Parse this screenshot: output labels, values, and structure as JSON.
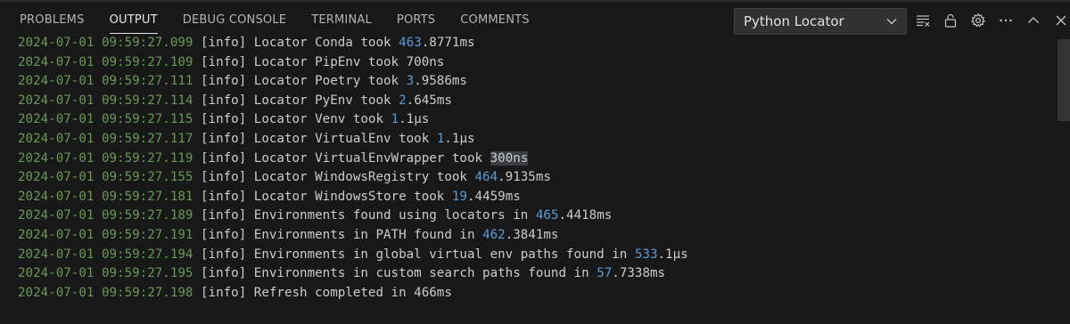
{
  "tabs": [
    {
      "label": "PROBLEMS",
      "active": false
    },
    {
      "label": "OUTPUT",
      "active": true
    },
    {
      "label": "DEBUG CONSOLE",
      "active": false
    },
    {
      "label": "TERMINAL",
      "active": false
    },
    {
      "label": "PORTS",
      "active": false
    },
    {
      "label": "COMMENTS",
      "active": false
    }
  ],
  "channel_select": {
    "selected": "Python Locator",
    "icon": "chevron-down-icon"
  },
  "actions": [
    {
      "name": "clear-output-icon"
    },
    {
      "name": "lock-scroll-icon"
    },
    {
      "name": "settings-gear-icon"
    },
    {
      "name": "more-actions-icon"
    },
    {
      "name": "maximize-panel-icon"
    },
    {
      "name": "close-panel-icon"
    }
  ],
  "colors": {
    "background": "#181818",
    "timestamp": "#6a9955",
    "number": "#569cd6",
    "text": "#cccccc",
    "selection": "#3a3d41"
  },
  "log_lines": [
    {
      "ts": "2024-07-01 09:59:27.099",
      "level": "[info]",
      "segments": [
        {
          "t": " Locator Conda took "
        },
        {
          "t": "463",
          "c": "num"
        },
        {
          "t": ".8771ms"
        }
      ]
    },
    {
      "ts": "2024-07-01 09:59:27.109",
      "level": "[info]",
      "segments": [
        {
          "t": " Locator PipEnv took 700ns"
        }
      ]
    },
    {
      "ts": "2024-07-01 09:59:27.111",
      "level": "[info]",
      "segments": [
        {
          "t": " Locator Poetry took "
        },
        {
          "t": "3",
          "c": "num"
        },
        {
          "t": ".9586ms"
        }
      ]
    },
    {
      "ts": "2024-07-01 09:59:27.114",
      "level": "[info]",
      "segments": [
        {
          "t": " Locator PyEnv took "
        },
        {
          "t": "2",
          "c": "num"
        },
        {
          "t": ".645ms"
        }
      ]
    },
    {
      "ts": "2024-07-01 09:59:27.115",
      "level": "[info]",
      "segments": [
        {
          "t": " Locator Venv took "
        },
        {
          "t": "1",
          "c": "num"
        },
        {
          "t": ".1µs"
        }
      ]
    },
    {
      "ts": "2024-07-01 09:59:27.117",
      "level": "[info]",
      "segments": [
        {
          "t": " Locator VirtualEnv took "
        },
        {
          "t": "1",
          "c": "num"
        },
        {
          "t": ".1µs"
        }
      ]
    },
    {
      "ts": "2024-07-01 09:59:27.119",
      "level": "[info]",
      "segments": [
        {
          "t": " Locator VirtualEnvWrapper took "
        },
        {
          "t": "300ns",
          "c": "hl"
        }
      ]
    },
    {
      "ts": "2024-07-01 09:59:27.155",
      "level": "[info]",
      "segments": [
        {
          "t": " Locator WindowsRegistry took "
        },
        {
          "t": "464",
          "c": "num"
        },
        {
          "t": ".9135ms"
        }
      ]
    },
    {
      "ts": "2024-07-01 09:59:27.181",
      "level": "[info]",
      "segments": [
        {
          "t": " Locator WindowsStore took "
        },
        {
          "t": "19",
          "c": "num"
        },
        {
          "t": ".4459ms"
        }
      ]
    },
    {
      "ts": "2024-07-01 09:59:27.189",
      "level": "[info]",
      "segments": [
        {
          "t": " Environments found using locators in "
        },
        {
          "t": "465",
          "c": "num"
        },
        {
          "t": ".4418ms"
        }
      ]
    },
    {
      "ts": "2024-07-01 09:59:27.191",
      "level": "[info]",
      "segments": [
        {
          "t": " Environments in PATH found in "
        },
        {
          "t": "462",
          "c": "num"
        },
        {
          "t": ".3841ms"
        }
      ]
    },
    {
      "ts": "2024-07-01 09:59:27.194",
      "level": "[info]",
      "segments": [
        {
          "t": " Environments in global virtual env paths found in "
        },
        {
          "t": "533",
          "c": "num"
        },
        {
          "t": ".1µs"
        }
      ]
    },
    {
      "ts": "2024-07-01 09:59:27.195",
      "level": "[info]",
      "segments": [
        {
          "t": " Environments in custom search paths found in "
        },
        {
          "t": "57",
          "c": "num"
        },
        {
          "t": ".7338ms"
        }
      ]
    },
    {
      "ts": "2024-07-01 09:59:27.198",
      "level": "[info]",
      "segments": [
        {
          "t": " Refresh completed in 466ms"
        }
      ]
    }
  ]
}
